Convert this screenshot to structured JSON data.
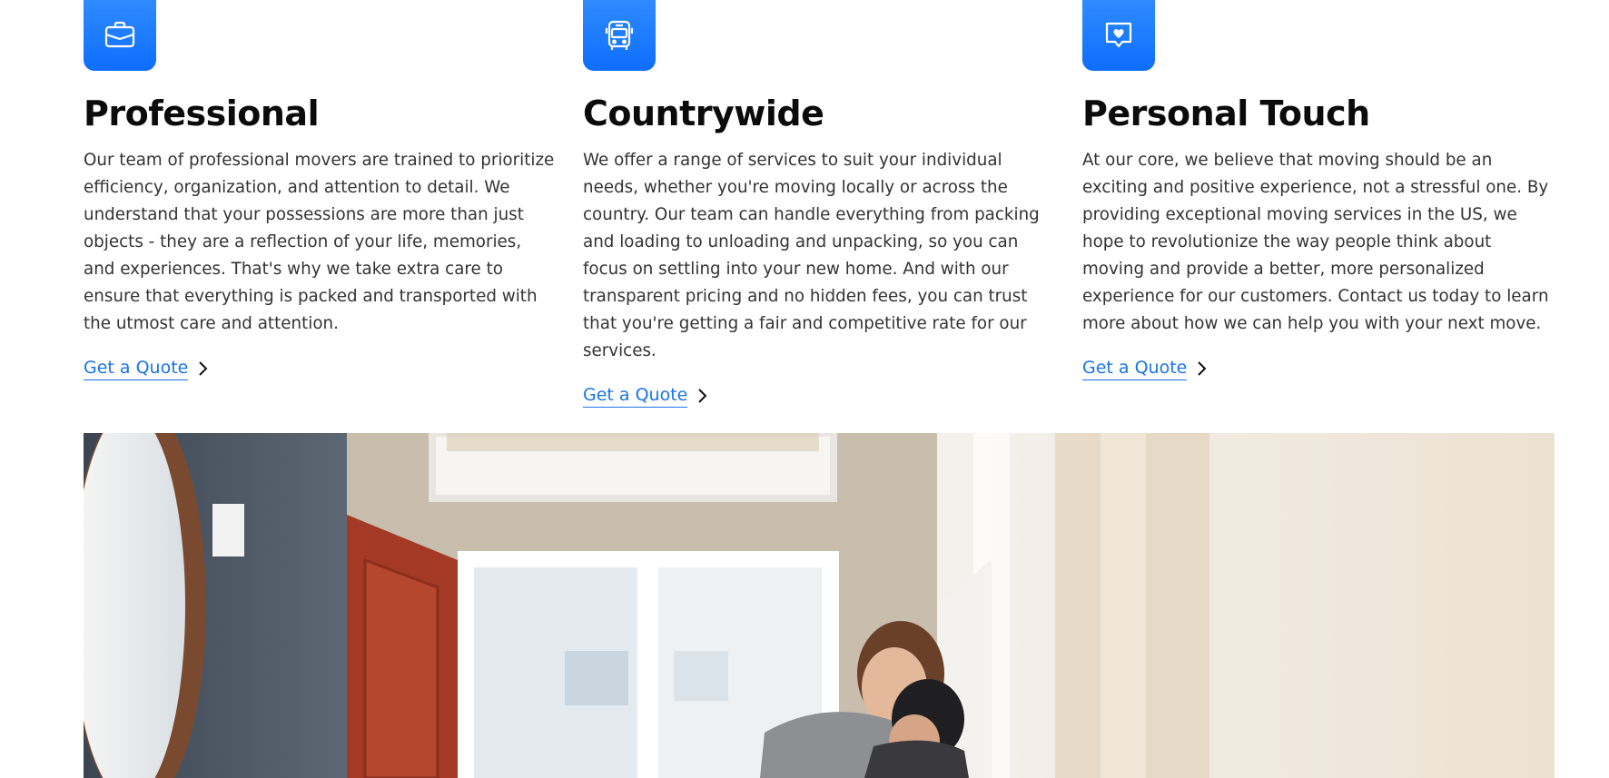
{
  "features": [
    {
      "icon": "briefcase-icon",
      "title": "Professional",
      "body": "Our team of professional movers are trained to prioritize efficiency, organization, and attention to detail. We understand that your possessions are more than just objects - they are a reflection of your life, memories, and experiences. That's why we take extra care to ensure that everything is packed and transported with the utmost care and attention.",
      "link": "Get a Quote"
    },
    {
      "icon": "bus-icon",
      "title": "Countrywide",
      "body": "We offer a range of services to suit your individual needs, whether you're moving locally or across the country. Our team can handle everything from packing and loading to unloading and unpacking, so you can focus on settling into your new home. And with our transparent pricing and no hidden fees, you can trust that you're getting a fair and competitive rate for our services.",
      "link": "Get a Quote"
    },
    {
      "icon": "chat-heart-icon",
      "title": "Personal Touch",
      "body": "At our core, we believe that moving should be an exciting and positive experience, not a stressful one. By providing exceptional moving services in the US, we hope to revolutionize the way people think about moving and provide a better, more personalized experience for our customers. Contact us today to learn more about how we can help you with your next move.",
      "link": "Get a Quote"
    }
  ],
  "colors": {
    "accent": "#0d6efd",
    "link": "#1a73e8",
    "heading": "#0b0b0b",
    "body": "#333333"
  }
}
